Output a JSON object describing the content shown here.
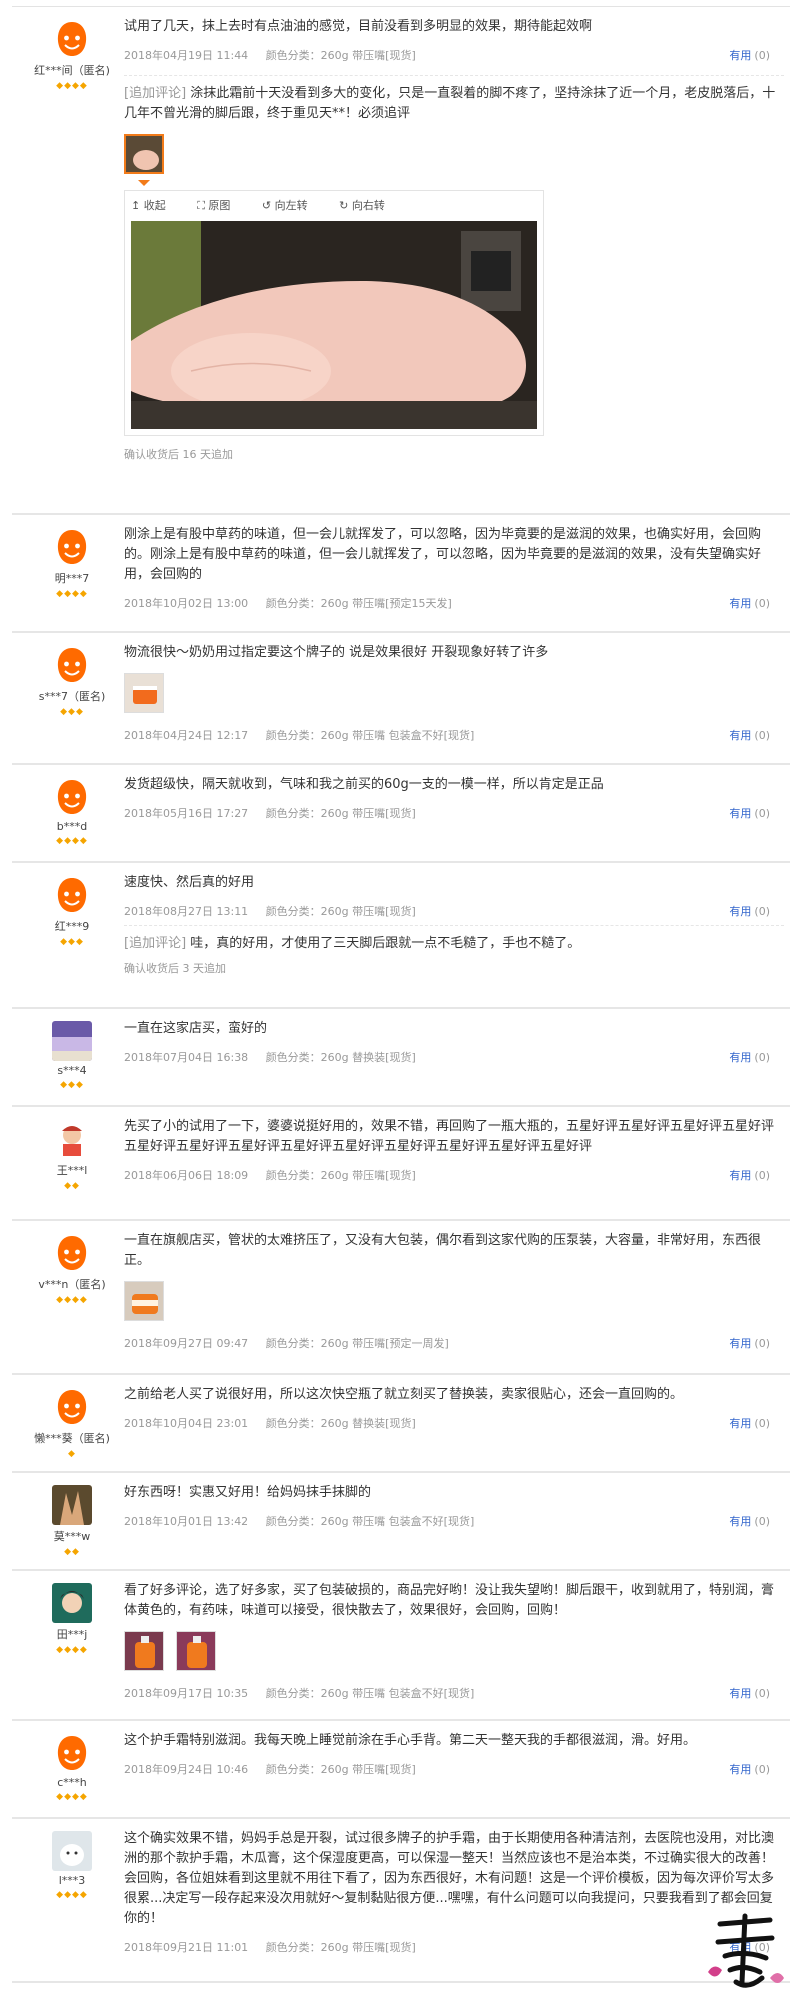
{
  "ui": {
    "useful_label": "有用",
    "append_label": "[追加评论]",
    "viewer_tools": [
      "收起",
      "原图",
      "向左转",
      "向右转"
    ]
  },
  "reviews": [
    {
      "nick": "红***间（匿名)",
      "level": 4,
      "avatar": "orange-mascot-icon",
      "text": "试用了几天，抹上去时有点油油的感觉，目前没看到多明显的效果，期待能起效啊",
      "date": "2018年04月19日 11:44",
      "sku": "颜色分类：260g 带压嘴[现货]",
      "useful_count": "(0)",
      "append": "涂抹此霜前十天没看到多大的变化，只是一直裂着的脚不疼了，坚持涂抹了近一个月，老皮脱落后，十几年不曾光滑的脚后跟，终于重见天**！必须追评",
      "confirm": "确认收货后 16 天追加"
    },
    {
      "nick": "明***7",
      "level": 4,
      "avatar": "orange-mascot-icon",
      "text": "刚涂上是有股中草药的味道，但一会儿就挥发了，可以忽略，因为毕竟要的是滋润的效果，也确实好用，会回购的。刚涂上是有股中草药的味道，但一会儿就挥发了，可以忽略，因为毕竟要的是滋润的效果，没有失望确实好用，会回购的",
      "date": "2018年10月02日 13:00",
      "sku": "颜色分类：260g 带压嘴[预定15天发]",
      "useful_count": "(0)"
    },
    {
      "nick": "s***7（匿名)",
      "level": 3,
      "avatar": "orange-mascot-icon",
      "text": "物流很快～奶奶用过指定要这个牌子的 说是效果很好 开裂现象好转了许多",
      "date": "2018年04月24日 12:17",
      "sku": "颜色分类：260g 带压嘴 包装盒不好[现货]",
      "useful_count": "(0)"
    },
    {
      "nick": "b***d",
      "level": 4,
      "avatar": "orange-mascot-icon",
      "text": "发货超级快，隔天就收到，气味和我之前买的60g一支的一模一样，所以肯定是正品",
      "date": "2018年05月16日 17:27",
      "sku": "颜色分类：260g 带压嘴[现货]",
      "useful_count": "(0)"
    },
    {
      "nick": "红***9",
      "level": 3,
      "avatar": "orange-mascot-icon",
      "text": "速度快、然后真的好用",
      "date": "2018年08月27日 13:11",
      "sku": "颜色分类：260g 带压嘴[现货]",
      "useful_count": "(0)",
      "append": "哇，真的好用，才使用了三天脚后跟就一点不毛糙了，手也不糙了。",
      "confirm": "确认收货后 3 天追加"
    },
    {
      "nick": "s***4",
      "level": 3,
      "avatar": "sky-photo-avatar",
      "text": "一直在这家店买，蛮好的",
      "date": "2018年07月04日 16:38",
      "sku": "颜色分类：260g 替换装[现货]",
      "useful_count": "(0)"
    },
    {
      "nick": "王***l",
      "level": 2,
      "avatar": "cartoon-avatar",
      "text": "先买了小的试用了一下，婆婆说挺好用的，效果不错，再回购了一瓶大瓶的，五星好评五星好评五星好评五星好评五星好评五星好评五星好评五星好评五星好评五星好评五星好评五星好评五星好评",
      "date": "2018年06月06日 18:09",
      "sku": "颜色分类：260g 带压嘴[现货]",
      "useful_count": "(0)"
    },
    {
      "nick": "v***n（匿名)",
      "level": 4,
      "avatar": "orange-mascot-icon",
      "text": "一直在旗舰店买，管状的太难挤压了，又没有大包装，偶尔看到这家代购的压泵装，大容量，非常好用，东西很正。",
      "date": "2018年09月27日 09:47",
      "sku": "颜色分类：260g 带压嘴[预定一周发]",
      "useful_count": "(0)"
    },
    {
      "nick": "懒***葵（匿名)",
      "level": 1,
      "avatar": "orange-mascot-icon",
      "text": "之前给老人买了说很好用，所以这次快空瓶了就立刻买了替换装，卖家很贴心，还会一直回购的。",
      "date": "2018年10月04日 23:01",
      "sku": "颜色分类：260g 替换装[现货]",
      "useful_count": "(0)"
    },
    {
      "nick": "莫***w",
      "level": 2,
      "avatar": "hand-photo-avatar",
      "text": "好东西呀！实惠又好用！给妈妈抹手抹脚的",
      "date": "2018年10月01日 13:42",
      "sku": "颜色分类：260g 带压嘴 包装盒不好[现货]",
      "useful_count": "(0)"
    },
    {
      "nick": "田***j",
      "level": 4,
      "avatar": "anime-avatar",
      "text": "看了好多评论，选了好多家，买了包装破损的，商品完好哟！没让我失望哟！脚后跟干，收到就用了，特别润，膏体黄色的，有药味，味道可以接受，很快散去了，效果很好，会回购，回购！",
      "date": "2018年09月17日 10:35",
      "sku": "颜色分类：260g 带压嘴 包装盒不好[现货]",
      "useful_count": "(0)"
    },
    {
      "nick": "c***h",
      "level": 4,
      "avatar": "orange-mascot-icon",
      "text": "这个护手霜特别滋润。我每天晚上睡觉前涂在手心手背。第二天一整天我的手都很滋润，滑。好用。",
      "date": "2018年09月24日 10:46",
      "sku": "颜色分类：260g 带压嘴[现货]",
      "useful_count": "(0)"
    },
    {
      "nick": "l***3",
      "level": 4,
      "avatar": "white-pet-avatar",
      "text": "这个确实效果不错，妈妈手总是开裂，试过很多牌子的护手霜，由于长期使用各种清洁剂，去医院也没用，对比澳洲的那个款护手霜，木瓜膏，这个保湿度更高，可以保湿一整天！当然应该也不是治本类，不过确实很大的改善！会回购，各位姐妹看到这里就不用往下看了，因为东西很好，木有问题！这是一个评价模板，因为每次评价写太多很累...决定写一段存起来没次用就好～复制黏贴很方便...嘿嘿，有什么问题可以向我提问，只要我看到了都会回复你的！",
      "date": "2018年09月21日 11:01",
      "sku": "颜色分类：260g 带压嘴[现货]",
      "useful_count": "(0)"
    }
  ]
}
